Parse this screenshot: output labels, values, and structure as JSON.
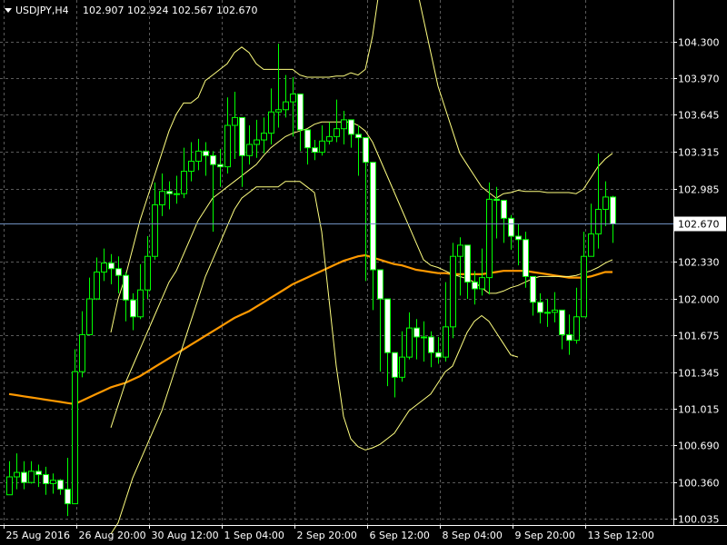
{
  "header": {
    "symbol": "USDJPY,H4",
    "ohlc": "102.907 102.924 102.567 102.670"
  },
  "colors": {
    "background": "#000000",
    "grid": "#5a5a5a",
    "candle": "#00ff00",
    "candle_bull_body": "#000000",
    "candle_bear_body": "#ffffff",
    "bands": "#ffff80",
    "moving_average": "#ff9900",
    "price_line": "#6f8fbf",
    "text": "#ffffff"
  },
  "chart_data": {
    "type": "candlestick",
    "symbol": "USDJPY",
    "timeframe": "H4",
    "current_price": 102.67,
    "current_price_label": "102.670",
    "y_ticks": [
      "104.300",
      "103.970",
      "103.645",
      "103.315",
      "102.985",
      "102.330",
      "102.000",
      "101.675",
      "101.345",
      "101.015",
      "100.690",
      "100.360",
      "100.035"
    ],
    "ylim": [
      99.98,
      104.67
    ],
    "x_labels": [
      {
        "bar": 0,
        "text": "25 Aug 2016"
      },
      {
        "bar": 10,
        "text": "26 Aug 20:00"
      },
      {
        "bar": 20,
        "text": "30 Aug 12:00"
      },
      {
        "bar": 30,
        "text": "1 Sep 04:00"
      },
      {
        "bar": 40,
        "text": "2 Sep 20:00"
      },
      {
        "bar": 50,
        "text": "6 Sep 12:00"
      },
      {
        "bar": 60,
        "text": "8 Sep 04:00"
      },
      {
        "bar": 70,
        "text": "9 Sep 20:00"
      },
      {
        "bar": 80,
        "text": "13 Sep 12:00"
      }
    ],
    "close": [
      100.41,
      100.45,
      100.36,
      100.46,
      100.43,
      100.35,
      100.38,
      100.3,
      100.17,
      101.35,
      101.68,
      102.0,
      102.24,
      102.32,
      102.27,
      102.21,
      101.99,
      101.84,
      102.08,
      102.38,
      102.84,
      102.96,
      102.94,
      102.94,
      103.14,
      103.23,
      103.32,
      103.28,
      103.2,
      103.18,
      103.55,
      103.62,
      103.28,
      103.38,
      103.42,
      103.48,
      103.67,
      103.69,
      103.76,
      103.83,
      103.51,
      103.35,
      103.31,
      103.41,
      103.45,
      103.52,
      103.6,
      103.47,
      103.44,
      103.22,
      102.26,
      102.0,
      101.52,
      101.3,
      101.48,
      101.74,
      101.66,
      101.66,
      101.52,
      101.48,
      101.75,
      102.38,
      102.48,
      102.15,
      102.09,
      102.19,
      102.89,
      102.88,
      102.72,
      102.56,
      102.53,
      102.2,
      101.97,
      101.88,
      101.88,
      101.9,
      101.68,
      101.63,
      101.84,
      102.38,
      102.58,
      102.8,
      102.91,
      102.67
    ],
    "high": [
      100.55,
      100.62,
      100.55,
      100.55,
      100.52,
      100.5,
      100.44,
      100.39,
      100.58,
      101.55,
      101.89,
      102.19,
      102.37,
      102.45,
      102.4,
      102.38,
      102.24,
      102.05,
      102.31,
      102.56,
      103.04,
      103.12,
      103.05,
      103.1,
      103.35,
      103.4,
      103.43,
      103.4,
      103.32,
      103.34,
      103.8,
      103.85,
      103.5,
      103.55,
      103.6,
      103.62,
      103.88,
      104.28,
      104.0,
      103.98,
      103.78,
      103.5,
      103.42,
      103.55,
      103.58,
      103.78,
      103.68,
      103.58,
      103.55,
      103.35,
      102.42,
      102.1,
      101.69,
      101.5,
      101.71,
      101.88,
      101.82,
      101.8,
      101.71,
      101.66,
      102.15,
      102.5,
      102.55,
      102.32,
      102.25,
      102.45,
      103.04,
      103.0,
      102.85,
      102.75,
      102.67,
      102.6,
      102.1,
      102.05,
      102.0,
      102.06,
      101.89,
      101.86,
      102.1,
      102.6,
      102.85,
      103.3,
      103.05,
      102.92
    ],
    "low": [
      100.35,
      100.3,
      100.3,
      100.35,
      100.32,
      100.25,
      100.26,
      100.25,
      100.06,
      100.3,
      101.3,
      101.68,
      101.99,
      102.16,
      102.13,
      102.05,
      101.8,
      101.72,
      101.82,
      102.0,
      102.35,
      102.74,
      102.8,
      102.85,
      102.9,
      103.05,
      103.15,
      103.1,
      102.6,
      103.0,
      103.12,
      103.25,
      103.0,
      103.2,
      103.26,
      103.3,
      103.38,
      103.53,
      103.62,
      103.45,
      103.32,
      103.2,
      103.24,
      103.28,
      103.38,
      103.4,
      103.38,
      103.35,
      103.1,
      102.16,
      101.9,
      101.35,
      101.22,
      101.12,
      101.26,
      101.46,
      101.46,
      101.44,
      101.39,
      101.42,
      101.44,
      101.65,
      102.03,
      102.0,
      101.95,
      102.03,
      102.04,
      102.54,
      102.5,
      102.44,
      102.3,
      102.1,
      101.85,
      101.78,
      101.75,
      101.79,
      101.55,
      101.5,
      101.6,
      101.84,
      102.4,
      102.45,
      102.65,
      102.5
    ],
    "open": [
      100.25,
      100.41,
      100.45,
      100.36,
      100.46,
      100.43,
      100.35,
      100.38,
      100.3,
      100.17,
      101.35,
      101.68,
      102.0,
      102.24,
      102.32,
      102.27,
      102.21,
      101.99,
      101.84,
      102.08,
      102.38,
      102.84,
      102.96,
      102.94,
      102.94,
      103.14,
      103.23,
      103.32,
      103.28,
      103.2,
      103.18,
      103.55,
      103.62,
      103.28,
      103.38,
      103.42,
      103.48,
      103.67,
      103.69,
      103.76,
      103.83,
      103.51,
      103.35,
      103.31,
      103.41,
      103.45,
      103.52,
      103.6,
      103.47,
      103.44,
      103.22,
      102.26,
      102.0,
      101.52,
      101.3,
      101.48,
      101.74,
      101.66,
      101.66,
      101.52,
      101.48,
      101.75,
      102.38,
      102.48,
      102.15,
      102.09,
      102.19,
      102.89,
      102.88,
      102.72,
      102.56,
      102.53,
      102.2,
      101.97,
      101.88,
      101.88,
      101.9,
      101.68,
      101.63,
      101.84,
      102.38,
      102.58,
      102.8,
      102.91
    ],
    "series": [
      {
        "name": "",
        "style": "moving_average",
        "values": [
          101.15,
          101.14,
          101.13,
          101.12,
          101.11,
          101.1,
          101.09,
          101.08,
          101.07,
          101.06,
          101.09,
          101.12,
          101.15,
          101.18,
          101.21,
          101.23,
          101.25,
          101.28,
          101.31,
          101.35,
          101.39,
          101.43,
          101.47,
          101.51,
          101.55,
          101.59,
          101.63,
          101.67,
          101.71,
          101.75,
          101.79,
          101.83,
          101.86,
          101.89,
          101.93,
          101.97,
          102.01,
          102.05,
          102.09,
          102.13,
          102.16,
          102.19,
          102.22,
          102.25,
          102.28,
          102.31,
          102.34,
          102.36,
          102.38,
          102.39,
          102.37,
          102.35,
          102.33,
          102.31,
          102.3,
          102.28,
          102.26,
          102.25,
          102.24,
          102.23,
          102.23,
          102.22,
          102.22,
          102.22,
          102.22,
          102.22,
          102.23,
          102.24,
          102.25,
          102.25,
          102.25,
          102.25,
          102.24,
          102.23,
          102.22,
          102.21,
          102.2,
          102.19,
          102.19,
          102.19,
          102.2,
          102.22,
          102.24,
          102.24
        ]
      },
      {
        "name": "",
        "style": "band_upper",
        "values": [
          null,
          null,
          null,
          null,
          null,
          null,
          null,
          null,
          null,
          null,
          null,
          null,
          null,
          null,
          101.7,
          102.0,
          102.2,
          102.45,
          102.7,
          102.9,
          103.1,
          103.3,
          103.5,
          103.65,
          103.75,
          103.75,
          103.8,
          103.95,
          104.0,
          104.05,
          104.1,
          104.2,
          104.25,
          104.2,
          104.1,
          104.05,
          104.05,
          104.05,
          104.05,
          104.05,
          104.0,
          103.98,
          103.98,
          103.98,
          103.98,
          103.99,
          103.99,
          104.02,
          104.0,
          104.05,
          104.35,
          104.8,
          105.0,
          105.1,
          105.1,
          105.0,
          104.8,
          104.5,
          104.2,
          103.9,
          103.7,
          103.5,
          103.3,
          103.2,
          103.1,
          103.0,
          102.95,
          102.9,
          102.94,
          102.95,
          102.97,
          102.96,
          102.96,
          102.96,
          102.95,
          102.95,
          102.95,
          102.95,
          102.94,
          102.98,
          103.08,
          103.18,
          103.25,
          103.3
        ]
      },
      {
        "name": "",
        "style": "band_middle",
        "values": [
          null,
          null,
          null,
          null,
          null,
          null,
          null,
          null,
          null,
          null,
          null,
          null,
          null,
          null,
          100.85,
          101.05,
          101.25,
          101.4,
          101.55,
          101.7,
          101.85,
          102.0,
          102.15,
          102.25,
          102.4,
          102.55,
          102.7,
          102.8,
          102.9,
          102.95,
          103.0,
          103.05,
          103.1,
          103.15,
          103.2,
          103.28,
          103.35,
          103.4,
          103.45,
          103.48,
          103.5,
          103.52,
          103.56,
          103.58,
          103.58,
          103.58,
          103.58,
          103.58,
          103.55,
          103.5,
          103.4,
          103.25,
          103.1,
          102.95,
          102.8,
          102.65,
          102.5,
          102.35,
          102.3,
          102.28,
          102.25,
          102.22,
          102.2,
          102.18,
          102.15,
          102.1,
          102.05,
          102.05,
          102.07,
          102.1,
          102.12,
          102.15,
          102.18,
          102.2,
          102.2,
          102.2,
          102.2,
          102.2,
          102.21,
          102.23,
          102.25,
          102.28,
          102.32,
          102.35
        ]
      },
      {
        "name": "",
        "style": "band_lower",
        "values": [
          null,
          null,
          null,
          null,
          null,
          null,
          null,
          null,
          null,
          null,
          null,
          null,
          null,
          null,
          99.9,
          100.0,
          100.2,
          100.4,
          100.55,
          100.7,
          100.85,
          101.0,
          101.2,
          101.4,
          101.6,
          101.8,
          102.0,
          102.2,
          102.35,
          102.5,
          102.65,
          102.8,
          102.9,
          102.95,
          103.0,
          103.0,
          103.0,
          103.0,
          103.05,
          103.05,
          103.05,
          103.0,
          102.95,
          102.6,
          102.0,
          101.4,
          100.95,
          100.75,
          100.68,
          100.65,
          100.67,
          100.7,
          100.75,
          100.8,
          100.9,
          101.0,
          101.05,
          101.1,
          101.15,
          101.25,
          101.35,
          101.4,
          101.55,
          101.7,
          101.8,
          101.85,
          101.8,
          101.7,
          101.6,
          101.5,
          101.48
        ]
      }
    ]
  }
}
